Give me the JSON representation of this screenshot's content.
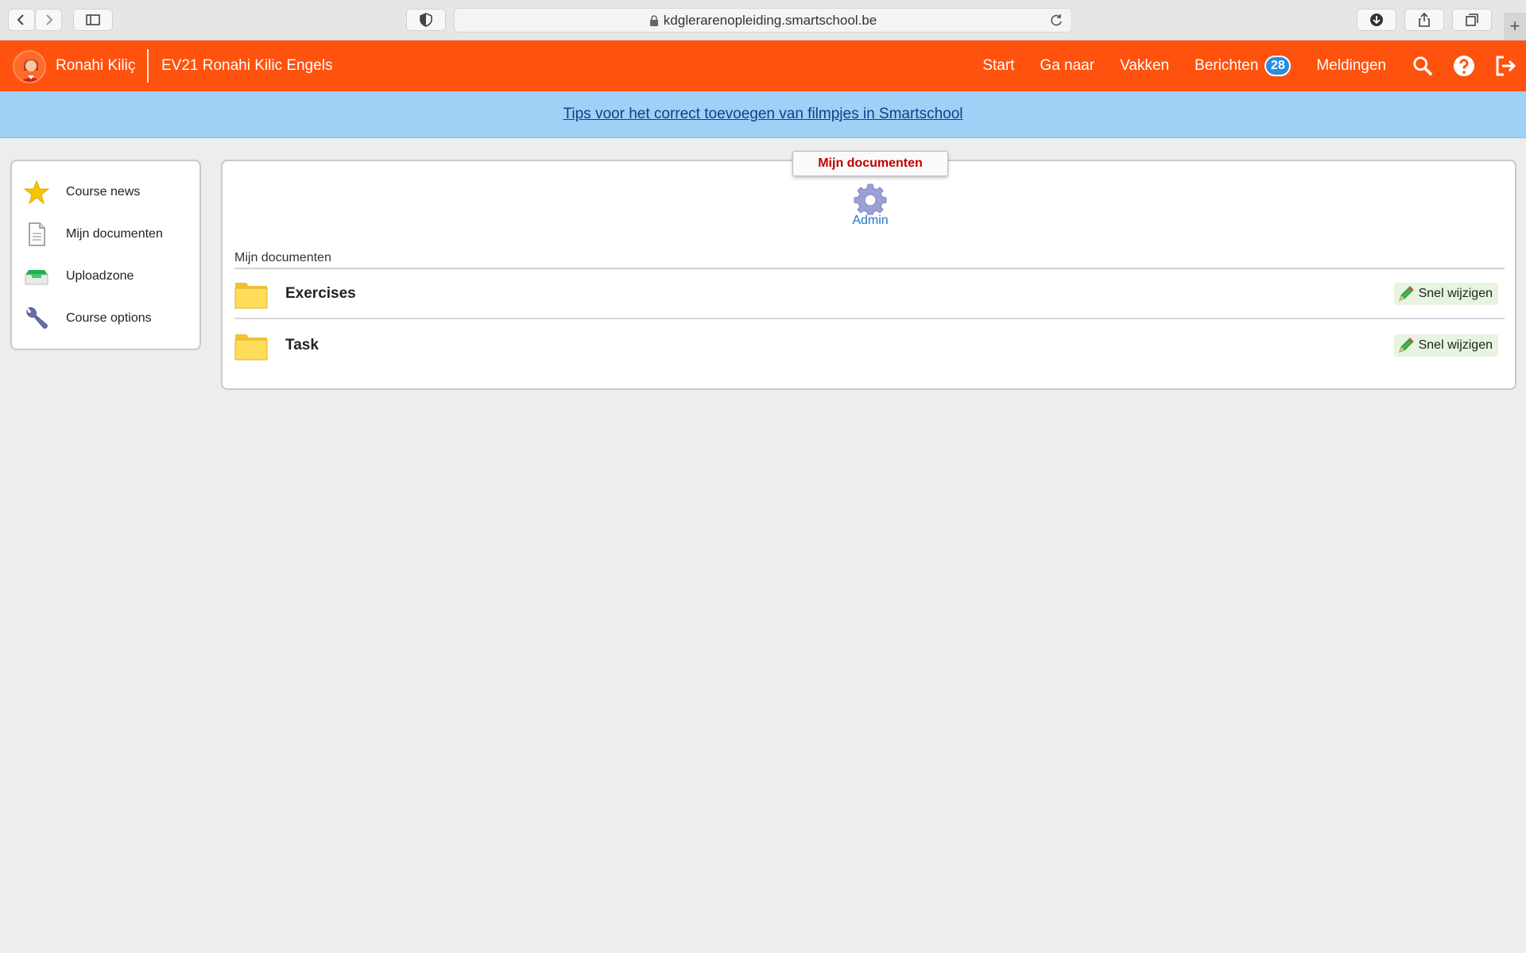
{
  "browser": {
    "url": "kdglerarenopleiding.smartschool.be",
    "new_tab_label": "+"
  },
  "header": {
    "user_name": "Ronahi Kiliç",
    "course_title": "EV21 Ronahi Kilic Engels",
    "nav": [
      {
        "label": "Start"
      },
      {
        "label": "Ga naar"
      },
      {
        "label": "Vakken"
      },
      {
        "label": "Berichten",
        "badge": "28"
      },
      {
        "label": "Meldingen"
      }
    ]
  },
  "banner": {
    "link_text": "Tips voor het correct toevoegen van filmpjes in Smartschool"
  },
  "sidebar": {
    "items": [
      {
        "label": "Course news",
        "icon": "star-icon"
      },
      {
        "label": "Mijn documenten",
        "icon": "document-icon"
      },
      {
        "label": "Uploadzone",
        "icon": "inbox-tray-icon"
      },
      {
        "label": "Course options",
        "icon": "wrench-icon"
      }
    ]
  },
  "main": {
    "tab_label": "Mijn documenten",
    "admin_label": "Admin",
    "section_title": "Mijn documenten",
    "folders": [
      {
        "name": "Exercises",
        "action": "Snel wijzigen"
      },
      {
        "name": "Task",
        "action": "Snel wijzigen"
      }
    ]
  },
  "colors": {
    "brand_orange": "#ff520e",
    "banner_blue": "#9fd0f5",
    "badge_blue": "#2a8de3",
    "tab_red": "#c00000"
  }
}
